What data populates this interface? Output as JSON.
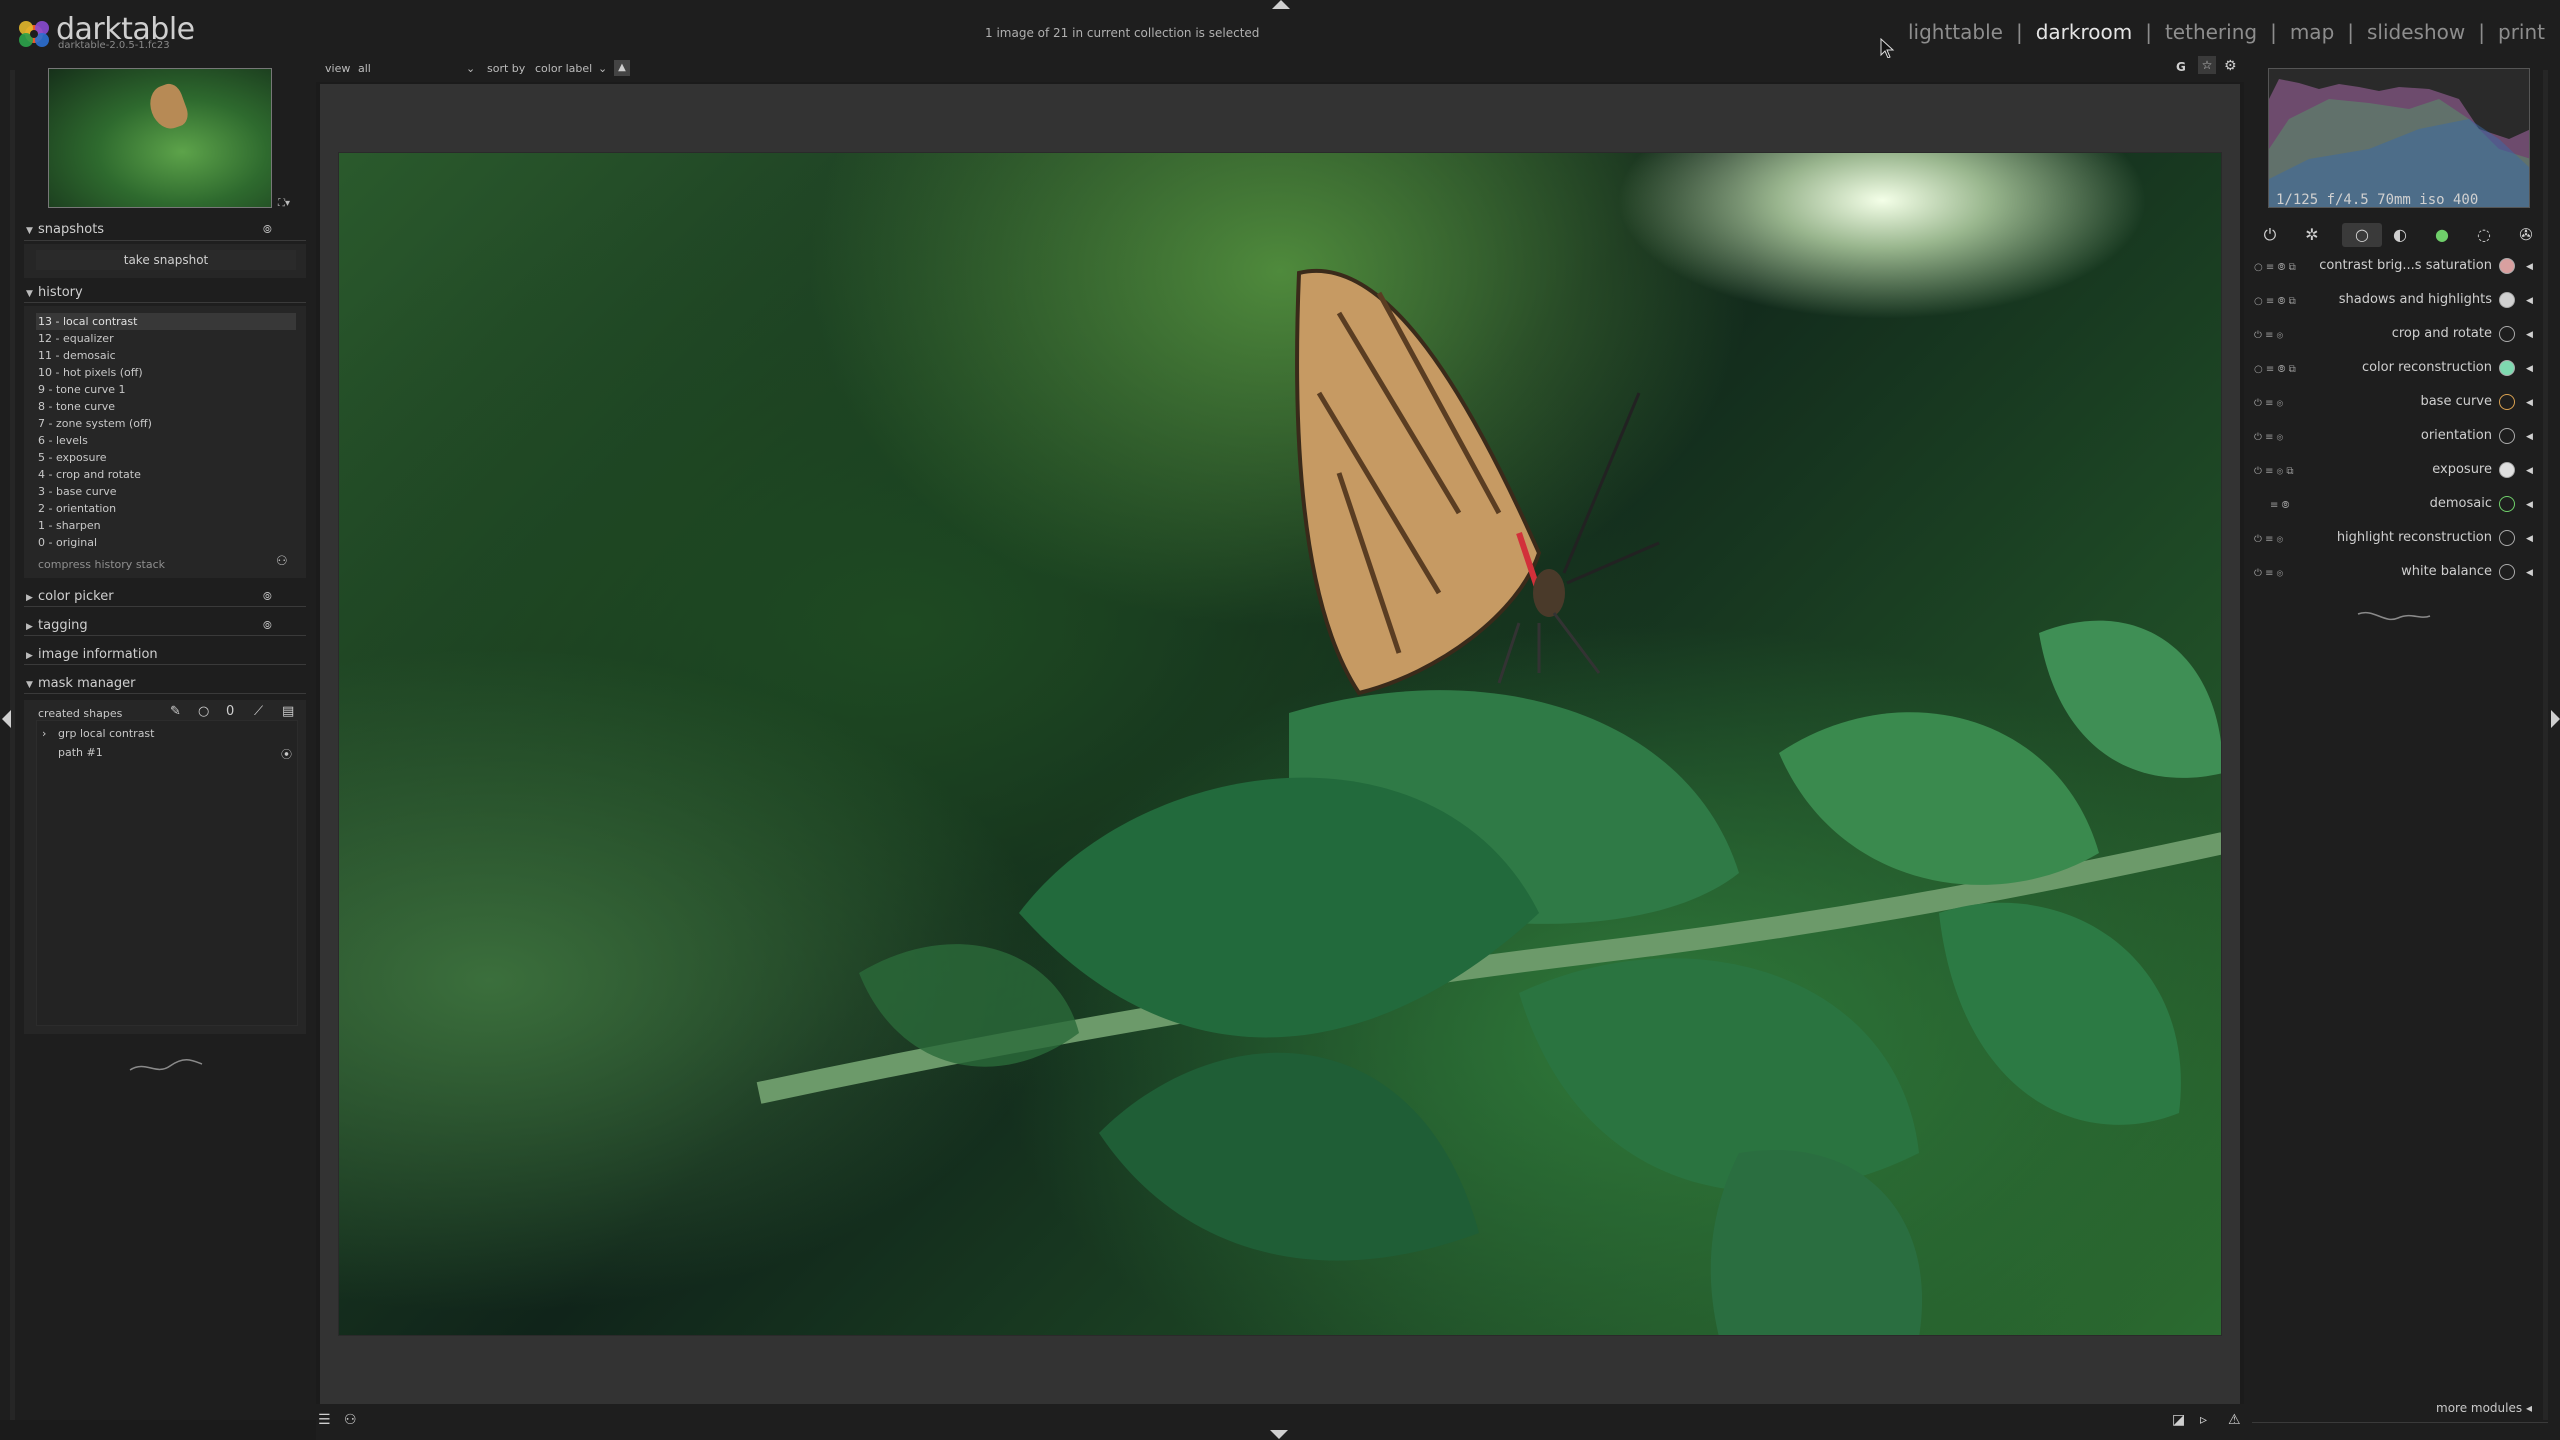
{
  "app": {
    "name": "darktable",
    "version": "darktable-2.0.5-1.fc23",
    "status": "1 image of 21 in current collection is selected"
  },
  "nav": {
    "items": [
      {
        "label": "lighttable",
        "active": false
      },
      {
        "label": "darkroom",
        "active": true
      },
      {
        "label": "tethering",
        "active": false
      },
      {
        "label": "map",
        "active": false
      },
      {
        "label": "slideshow",
        "active": false
      },
      {
        "label": "print",
        "active": false
      }
    ],
    "separator": "|"
  },
  "toolbar": {
    "view_label": "view",
    "view_value": "all",
    "sort_label": "sort by",
    "sort_value": "color label",
    "sort_dir_icon": "sort-ascending-icon",
    "right_icons": [
      "grouping-G-icon",
      "star-icon",
      "gear-icon"
    ],
    "grouping_glyph": "G"
  },
  "left": {
    "snapshots": {
      "title": "snapshots",
      "button": "take snapshot"
    },
    "history": {
      "title": "history",
      "items": [
        "13 - local contrast",
        "12 - equalizer",
        "11 - demosaic",
        "10 - hot pixels (off)",
        "9 - tone curve 1",
        "8 - tone curve",
        "7 - zone system (off)",
        "6 - levels",
        "5 - exposure",
        "4 - crop and rotate",
        "3 - base curve",
        "2 - orientation",
        "1 - sharpen",
        "0 - original"
      ],
      "active_index": 0,
      "compress": "compress history stack"
    },
    "color_picker": {
      "title": "color picker"
    },
    "tagging": {
      "title": "tagging"
    },
    "image_information": {
      "title": "image information"
    },
    "mask_manager": {
      "title": "mask manager",
      "created_shapes": "created shapes",
      "group": "grp local contrast",
      "path": "path #1"
    }
  },
  "right": {
    "histogram_info": "1/125 f/4.5 70mm iso 400",
    "groups": [
      {
        "icon": "power-icon",
        "active": false
      },
      {
        "icon": "favorite-star-icon",
        "active": false
      },
      {
        "icon": "basic-circle-icon",
        "active": true
      },
      {
        "icon": "tone-icon",
        "active": false
      },
      {
        "icon": "color-icon",
        "active": false
      },
      {
        "icon": "correct-icon",
        "active": false
      },
      {
        "icon": "effect-icon",
        "active": false
      }
    ],
    "modules": [
      {
        "name": "contrast brig...s saturation",
        "icon_color": "#d9a0a0"
      },
      {
        "name": "shadows and highlights",
        "icon_color": "#d0d0d0"
      },
      {
        "name": "crop and rotate",
        "icon_color": "#7c7c7c"
      },
      {
        "name": "color reconstruction",
        "icon_color": "#7fd9b0"
      },
      {
        "name": "base curve",
        "icon_color": "#d8a050"
      },
      {
        "name": "orientation",
        "icon_color": "#9a9a9a"
      },
      {
        "name": "exposure",
        "icon_color": "#e0e0e0"
      },
      {
        "name": "demosaic",
        "icon_color": "#6fcf6a"
      },
      {
        "name": "highlight reconstruction",
        "icon_color": "#9a9a9a"
      },
      {
        "name": "white balance",
        "icon_color": "#bdbdbd"
      }
    ],
    "more_modules": "more modules"
  },
  "bottom": {
    "left_icons": [
      "quick-access-menu-icon",
      "styles-icon"
    ],
    "right_icons": [
      "overexposure-icon",
      "softproof-icon",
      "gamut-check-icon"
    ]
  }
}
